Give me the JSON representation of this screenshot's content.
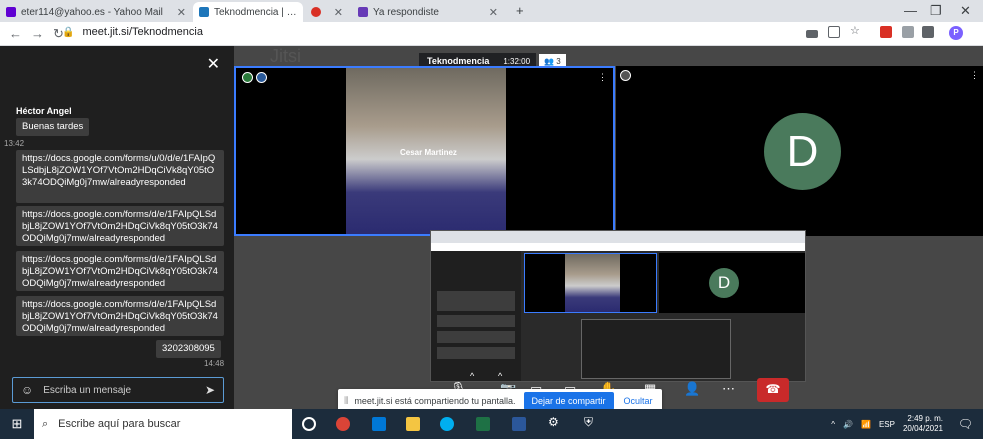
{
  "browser": {
    "tabs": [
      {
        "title": "eter114@yahoo.es - Yahoo Mail",
        "close": "✕",
        "color": "#6001d2"
      },
      {
        "title": "Teknodmencia | Jitsi Meet",
        "close": "",
        "color": "#1d76ba"
      },
      {
        "title": "",
        "close": "✕",
        "color": "#d93025"
      },
      {
        "title": "Ya respondiste",
        "close": "✕",
        "color": "#673ab7"
      }
    ],
    "new_tab": "+",
    "url": "meet.jit.si/Teknodmencia",
    "profile_initial": "P"
  },
  "chat": {
    "author": "Héctor Angel",
    "first_message": "Buenas tardes",
    "first_time": "13:42",
    "links": [
      "https://docs.google.com/forms/u/0/d/e/1FAIpQLSdbjL8jZOW1YOf7VtOm2HDqCiVk8qY05tO3k74ODQiMg0j7mw/alreadyresponded",
      "https://docs.google.com/forms/d/e/1FAIpQLSdbjL8jZOW1YOf7VtOm2HDqCiVk8qY05tO3k74ODQiMg0j7mw/alreadyresponded",
      "https://docs.google.com/forms/d/e/1FAIpQLSdbjL8jZOW1YOf7VtOm2HDqCiVk8qY05tO3k74ODQiMg0j7mw/alreadyresponded",
      "https://docs.google.com/forms/d/e/1FAIpQLSdbjL8jZOW1YOf7VtOm2HDqCiVk8qY05tO3k74ODQiMg0j7mw/alreadyresponded"
    ],
    "number_message": "3202308095",
    "last_time": "14:48",
    "input_placeholder": "Escriba un mensaje"
  },
  "meeting": {
    "title": "Teknodmencia",
    "timer": "1:32:00",
    "participants": "3",
    "watermark": "Jitsi",
    "main_name": "Cesar Martinez",
    "avatar_initial": "D"
  },
  "share_bar": {
    "message": "meet.jit.si está compartiendo tu pantalla.",
    "stop_label": "Dejar de compartir",
    "hide_label": "Ocultar"
  },
  "taskbar": {
    "search_placeholder": "Escribe aquí para buscar",
    "language": "ESP",
    "time": "2:49 p. m.",
    "date": "20/04/2021"
  }
}
